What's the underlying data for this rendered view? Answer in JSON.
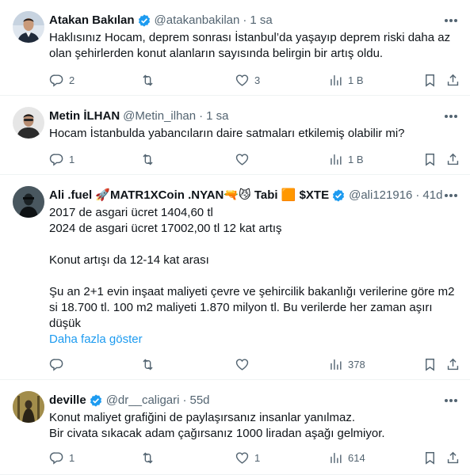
{
  "tweets": [
    {
      "name": "Atakan Bakılan",
      "handle": "@atakanbakilan",
      "separator": "·",
      "time": "1 sa",
      "verified": true,
      "lines": [
        "Haklısınız Hocam, deprem sonrası İstanbul’da yaşayıp deprem riski daha az",
        "olan şehirlerden konut alanların sayısında belirgin bir artış oldu."
      ],
      "replies": "2",
      "retweets": "",
      "likes": "3",
      "views": "1 B"
    },
    {
      "name": "Metin İLHAN",
      "handle": "@Metin_ilhan",
      "separator": "·",
      "time": "1 sa",
      "verified": false,
      "lines": [
        "Hocam İstanbulda yabancıların daire satmaları etkilemiş olabilir mi?"
      ],
      "replies": "1",
      "retweets": "",
      "likes": "",
      "views": "1 B"
    },
    {
      "name": "Ali .fuel 🚀MATR1XCoin .NYAN🔫😼 Tabi 🟧 $XTE",
      "handle": "@ali121916",
      "separator": "·",
      "time": "41d",
      "verified": true,
      "lines": [
        "2017 de asgari ücret 1404,60 tl",
        "2024 de asgari ücret 17002,00 tl 12 kat artış",
        "",
        "Konut artışı da 12-14 kat arası",
        "",
        "Şu an 2+1 evin inşaat maliyeti çevre ve şehircilik bakanlığı verilerine göre m2",
        "si 18.700 tl. 100 m2 maliyeti 1.870 milyon tl. Bu verilerde her zaman aşırı",
        "düşük"
      ],
      "show_more": "Daha fazla göster",
      "replies": "",
      "retweets": "",
      "likes": "",
      "views": "378"
    },
    {
      "name": "deville",
      "handle": "@dr__caligari",
      "separator": "·",
      "time": "55d",
      "verified": true,
      "lines": [
        "Konut maliyet grafiğini de paylaşırsanız insanlar yanılmaz.",
        "Bir civata sıkacak adam çağırsanız 1000 liradan aşağı gelmiyor."
      ],
      "replies": "1",
      "retweets": "",
      "likes": "1",
      "views": "614"
    }
  ],
  "colors": {
    "text": "#0f1419",
    "secondary": "#536471",
    "link": "#1d9bf0",
    "verified": "#1d9bf0",
    "divider": "#eff3f4"
  },
  "icons": [
    "reply-icon",
    "retweet-icon",
    "like-icon",
    "views-icon",
    "bookmark-icon",
    "share-icon",
    "more-icon",
    "verified-badge-icon"
  ]
}
